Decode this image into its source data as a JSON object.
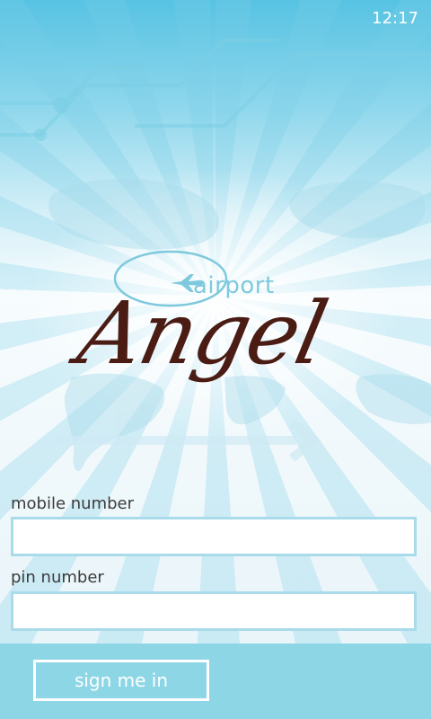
{
  "status_bar": {
    "time": "12:17"
  },
  "logo": {
    "small_word": "airport",
    "big_word": "Angel",
    "icon": "plane-icon"
  },
  "form": {
    "mobile_label": "mobile number",
    "mobile_value": "",
    "pin_label": "pin number",
    "pin_value": ""
  },
  "app_bar": {
    "signin_label": "sign me in"
  },
  "colors": {
    "accent": "#8dd6e6",
    "field_border": "#a9dbea",
    "logo_brown": "#4a1c14",
    "logo_blue": "#7ec9dd"
  }
}
